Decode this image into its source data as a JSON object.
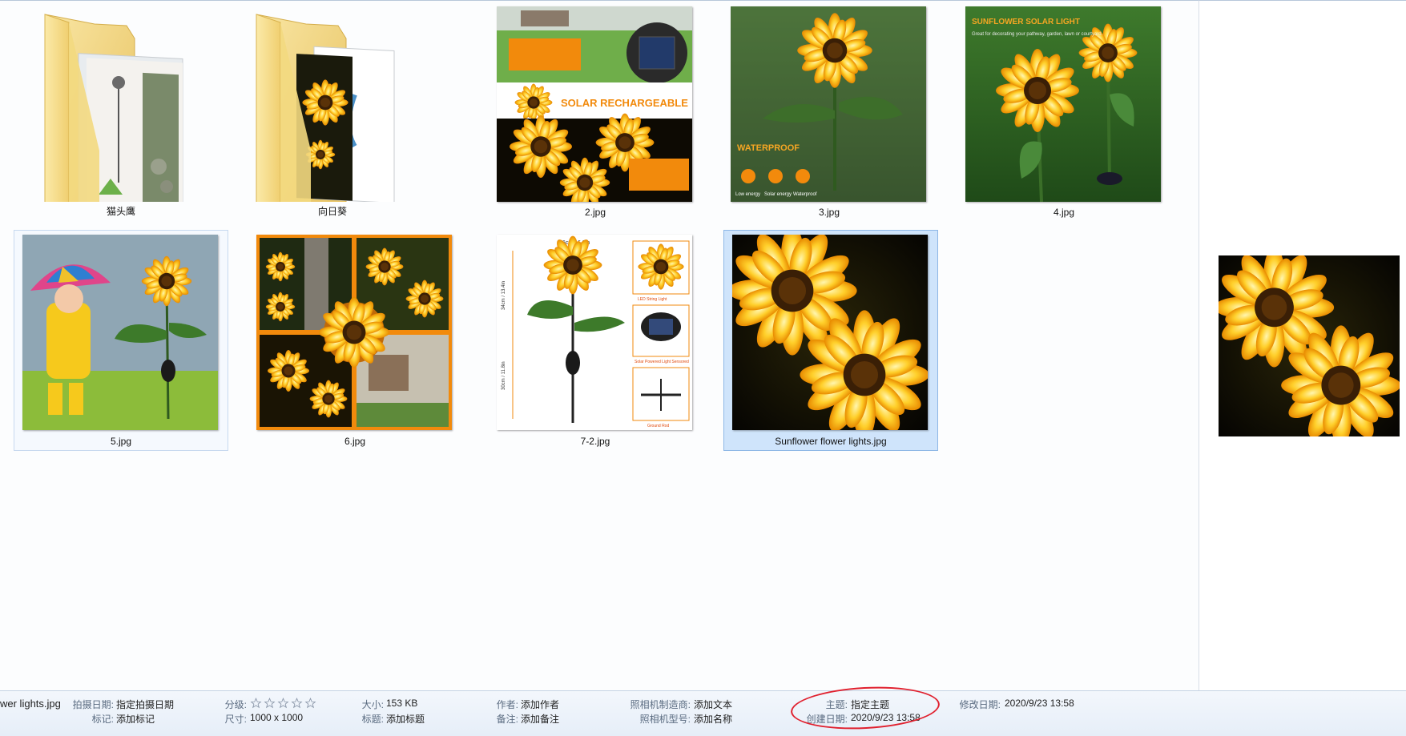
{
  "folders": [
    {
      "name": "猫头鹰"
    },
    {
      "name": "向日葵"
    }
  ],
  "files": [
    {
      "name": "2.jpg",
      "banner_text": "SOLAR RECHARGEABLE"
    },
    {
      "name": "3.jpg",
      "banner_text": "WATERPROOF",
      "icon_labels": [
        "Low energy",
        "Solar energy",
        "Waterproof"
      ]
    },
    {
      "name": "4.jpg",
      "banner_text": "SUNFLOWER SOLAR LIGHT",
      "sub_text": "Great for decorating your pathway, garden, lawn or courtyard."
    },
    {
      "name": "5.jpg"
    },
    {
      "name": "6.jpg"
    },
    {
      "name": "7-2.jpg",
      "labels": [
        "16cm / 6.3in",
        "34cm / 13.4in",
        "30cm / 11.8in",
        "LED String Light",
        "Solar Powered Light Sensored",
        "Ground Rod"
      ]
    },
    {
      "name": "Sunflower flower lights.jpg",
      "selected": true
    }
  ],
  "details": {
    "filename": "wer lights.jpg",
    "date_taken_label": "拍摄日期:",
    "date_taken_value": "指定拍摄日期",
    "tags_label": "标记:",
    "tags_value": "添加标记",
    "rating_label": "分级:",
    "rating": 0,
    "dimensions_label": "尺寸:",
    "dimensions_value": "1000 x 1000",
    "size_label": "大小:",
    "size_value": "153 KB",
    "title_label": "标题:",
    "title_value": "添加标题",
    "author_label": "作者:",
    "author_value": "添加作者",
    "comments_label": "备注:",
    "comments_value": "添加备注",
    "camera_maker_label": "照相机制造商:",
    "camera_maker_value": "添加文本",
    "camera_model_label": "照相机型号:",
    "camera_model_value": "添加名称",
    "subject_label": "主题:",
    "subject_value": "指定主题",
    "created_label": "创建日期:",
    "created_value": "2020/9/23 13:58",
    "modified_label": "修改日期:",
    "modified_value": "2020/9/23 13:58"
  },
  "colors": {
    "selection_bg": "#cfe4fb",
    "selection_border": "#8eb7e6",
    "folder_yellow": "#f6db8a",
    "annotation_red": "#e0202e"
  }
}
